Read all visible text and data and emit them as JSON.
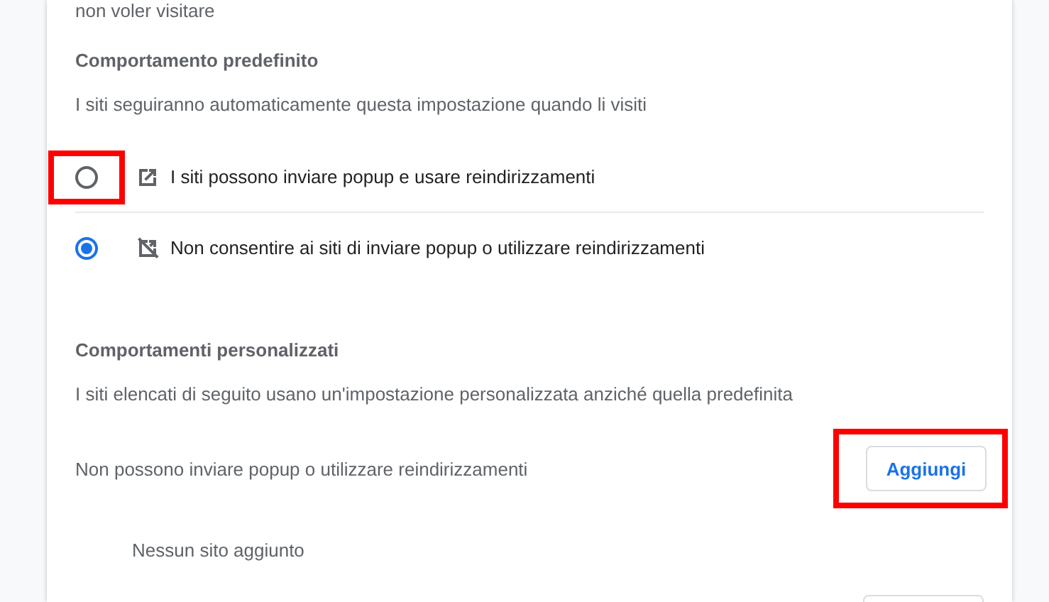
{
  "intro_tail": "non voler visitare",
  "default_section": {
    "heading": "Comportamento predefinito",
    "description": "I siti seguiranno automaticamente questa impostazione quando li visiti",
    "options": [
      {
        "label": "I siti possono inviare popup e usare reindirizzamenti",
        "kind": "allow",
        "selected": false,
        "highlighted": true
      },
      {
        "label": "Non consentire ai siti di inviare popup o utilizzare reindirizzamenti",
        "kind": "block",
        "selected": true,
        "highlighted": false
      }
    ]
  },
  "custom_section": {
    "heading": "Comportamenti personalizzati",
    "description": "I siti elencati di seguito usano un'impostazione personalizzata anziché quella predefinita",
    "lists": [
      {
        "title": "Non possono inviare popup o utilizzare reindirizzamenti",
        "button": "Aggiungi",
        "button_highlighted": true,
        "empty_text": "Nessun sito aggiunto"
      }
    ]
  }
}
